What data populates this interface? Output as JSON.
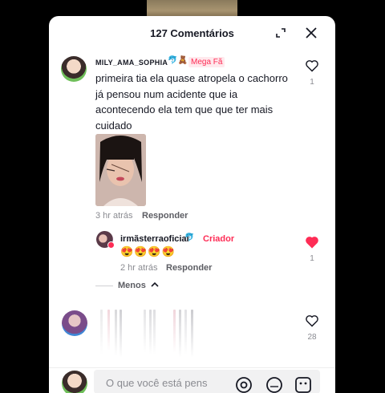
{
  "header": {
    "title": "127 Comentários",
    "expand_icon": "expand-icon",
    "close_icon": "close-icon"
  },
  "comments": [
    {
      "username": "MILY_AMA_SOPHIA",
      "username_emoji": "🐬🧸",
      "badge": "Mega Fã",
      "text": "primeira tia ela quase atropela o cachorro já pensou num acidente que ia acontecendo ela tem que que ter mais cuidado",
      "time": "3 hr atrás",
      "reply_label": "Responder",
      "like_count": "1",
      "liked": false
    }
  ],
  "reply": {
    "username": "irmãsterraoficial",
    "username_emoji": "🐬",
    "badge": "Criador",
    "text": "😍😍😍😍",
    "time": "2 hr atrás",
    "reply_label": "Responder",
    "like_count": "1",
    "liked": true
  },
  "collapse": {
    "label": "Menos"
  },
  "third_comment": {
    "like_count": "28"
  },
  "composer": {
    "placeholder": "O que você está pens",
    "icons": [
      "mention-icon",
      "gif-icon",
      "emoji-icon"
    ]
  },
  "colors": {
    "accent": "#fe2c55",
    "text": "#161823",
    "muted": "#8a8b91"
  }
}
